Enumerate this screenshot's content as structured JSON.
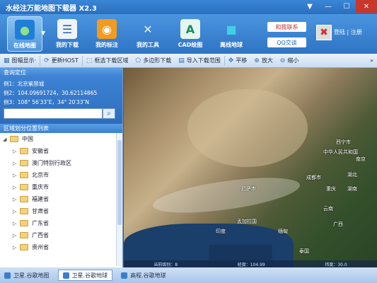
{
  "app": {
    "title": "水经注万能地图下载器 X2.3"
  },
  "window_buttons": {
    "menu": "▼",
    "minimize": "—",
    "maximize": "☐",
    "close": "✕"
  },
  "ribbon": {
    "buttons": [
      {
        "label": "在线地图",
        "icon": "globe-icon",
        "active": true
      },
      {
        "label": "我的下载",
        "icon": "download-list-icon"
      },
      {
        "label": "我的标注",
        "icon": "map-pin-icon"
      },
      {
        "label": "我的工具",
        "icon": "tools-icon"
      },
      {
        "label": "CAD绘图",
        "icon": "cad-icon"
      },
      {
        "label": "离线地球",
        "icon": "cubes-icon"
      }
    ],
    "contact_label": "和我联系",
    "qq_label": "QQ交谈",
    "login_label": "登陆",
    "register_label": "注册",
    "separator": "|"
  },
  "toolbar": {
    "items": [
      {
        "label": "图幅显示·",
        "icon": "grid-icon"
      },
      {
        "label": "更新HOST",
        "icon": "refresh-icon"
      },
      {
        "label": "框选下载区域",
        "icon": "select-box-icon"
      },
      {
        "label": "多边形下载",
        "icon": "polygon-icon"
      },
      {
        "label": "导入下载范围",
        "icon": "import-icon"
      },
      {
        "label": "平移",
        "icon": "pan-icon"
      },
      {
        "label": "放大",
        "icon": "zoom-in-icon"
      },
      {
        "label": "缩小",
        "icon": "zoom-out-icon"
      }
    ],
    "overflow": "»"
  },
  "left_panel": {
    "query_header": "查询定位",
    "examples": [
      "例1：北京紫禁城",
      "例2：104.09691724，30.62114865",
      "例3：108° 56′33″E，34° 20′33″N"
    ],
    "search_placeholder": "",
    "region_header": "区域划分位置列表",
    "tree_root": "中国",
    "tree_items": [
      "安徽省",
      "澳门特别行政区",
      "北京市",
      "重庆市",
      "福建省",
      "甘肃省",
      "广东省",
      "广西省",
      "贵州省"
    ]
  },
  "map": {
    "labels": [
      "中华人民共和国",
      "西宁市",
      "南京",
      "成都市",
      "湖北",
      "拉萨市",
      "重庆",
      "湖南",
      "云南",
      "孟加拉国",
      "印度",
      "缅甸",
      "广西",
      "泰国"
    ],
    "status": [
      "当前级别：8",
      "经度：104.99",
      "纬度：30.0"
    ]
  },
  "bottom_tabs": [
    {
      "label": "卫星.谷歌地图"
    },
    {
      "label": "卫星.谷歌地球",
      "active": true
    },
    {
      "label": "高程.谷歌地球"
    }
  ]
}
